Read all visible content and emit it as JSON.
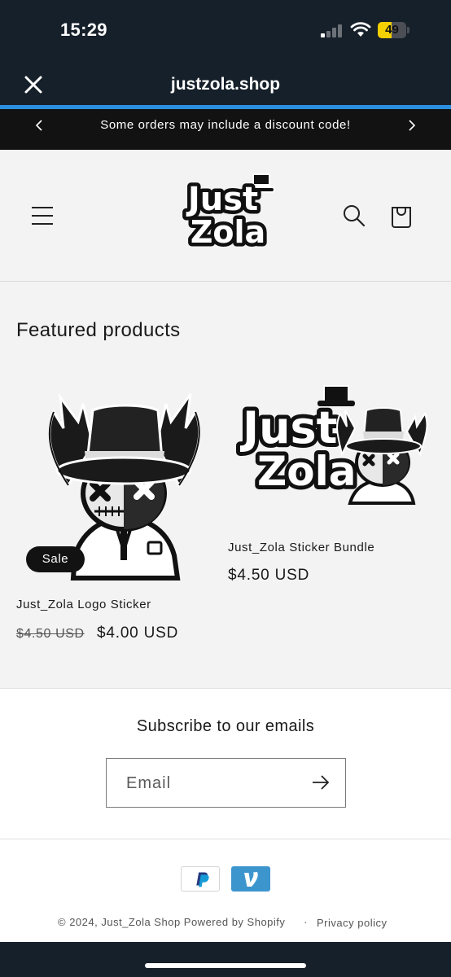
{
  "status_bar": {
    "time": "15:29",
    "battery": "49",
    "battery_level": 0.49
  },
  "browser": {
    "title": "justzola.shop"
  },
  "announcement": {
    "text": "Some orders may include a discount code!"
  },
  "header": {
    "logo_text": [
      "Just",
      "Zola"
    ],
    "icons": [
      "menu-icon",
      "search-icon",
      "cart-icon"
    ]
  },
  "featured": {
    "title": "Featured products",
    "products": [
      {
        "title": "Just_Zola Logo Sticker",
        "badge": "Sale",
        "old_price": "$4.50 USD",
        "price": "$4.00 USD"
      },
      {
        "title": "Just_Zola Sticker Bundle",
        "price": "$4.50 USD"
      }
    ]
  },
  "newsletter": {
    "title": "Subscribe to our emails",
    "email_placeholder": "Email"
  },
  "footer": {
    "payment_icons": [
      "paypal-icon",
      "venmo-icon"
    ],
    "copyright": "© 2024, Just_Zola Shop Powered by Shopify",
    "separator": "·",
    "privacy": "Privacy policy"
  },
  "colors": {
    "browser_bar": "#16202a",
    "accent_blue": "#2b8fe0",
    "announcement_bg": "#121212",
    "battery_yellow": "#f5d000",
    "venmo_blue": "#3d95ce"
  }
}
